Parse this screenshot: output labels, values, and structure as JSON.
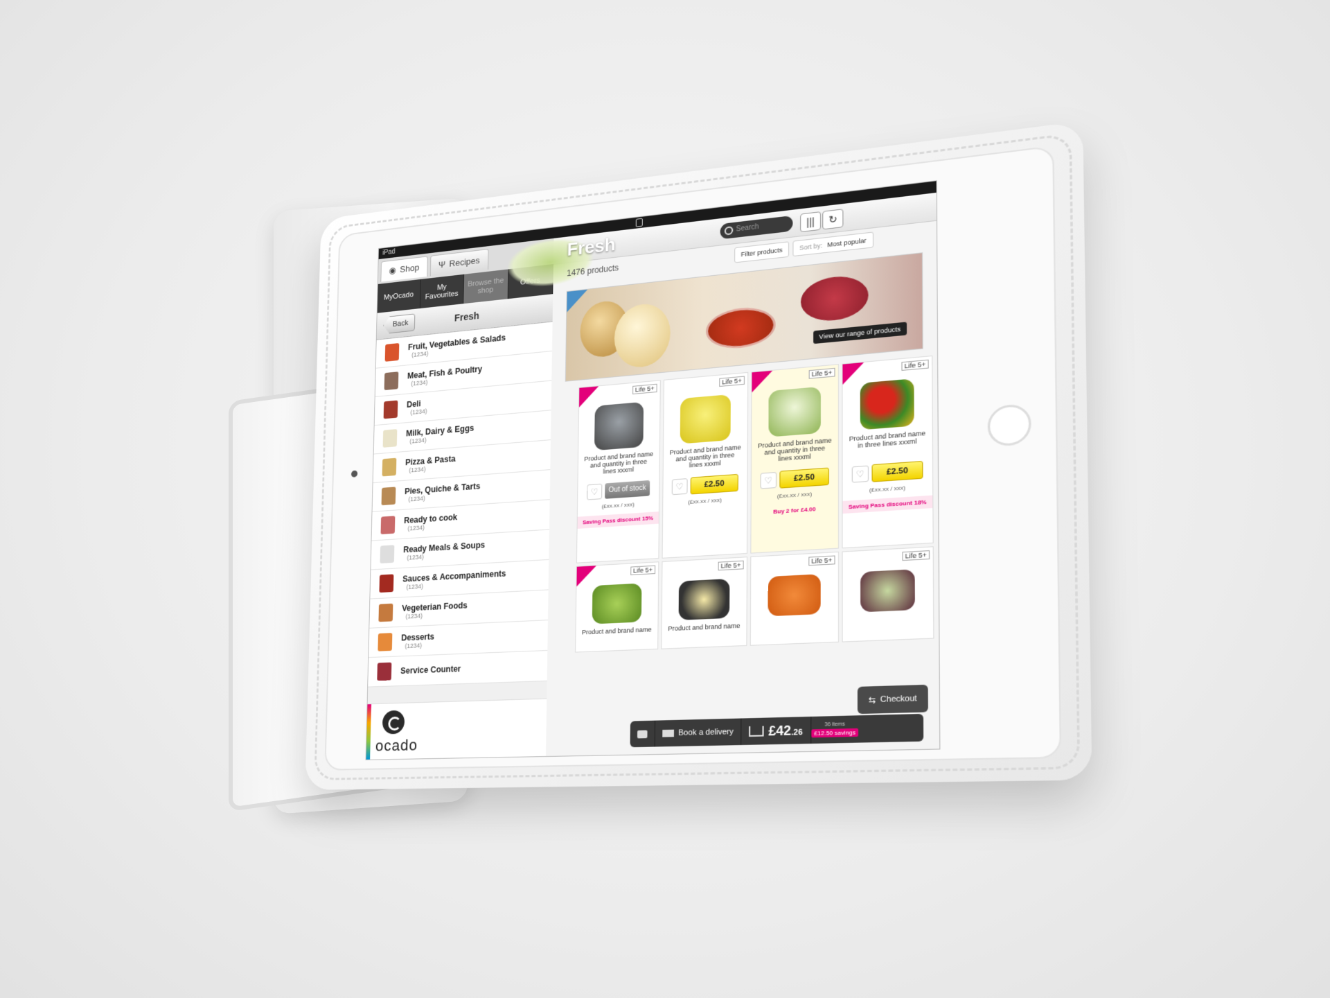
{
  "status": {
    "device": "iPad"
  },
  "tabs": [
    {
      "label": "Shop"
    },
    {
      "label": "Recipes"
    }
  ],
  "segments": [
    {
      "label": "MyOcado"
    },
    {
      "label": "My Favourites"
    },
    {
      "label": "Browse the shop"
    },
    {
      "label": "Offers"
    }
  ],
  "nav": {
    "back_label": "Back",
    "title": "Fresh"
  },
  "categories": [
    {
      "name": "Fruit, Vegetables & Salads",
      "count": "(1234)"
    },
    {
      "name": "Meat, Fish & Poultry",
      "count": "(1234)"
    },
    {
      "name": "Deli",
      "count": "(1234)"
    },
    {
      "name": "Milk, Dairy & Eggs",
      "count": "(1234)"
    },
    {
      "name": "Pizza & Pasta",
      "count": "(1234)"
    },
    {
      "name": "Pies, Quiche & Tarts",
      "count": "(1234)"
    },
    {
      "name": "Ready to cook",
      "count": "(1234)"
    },
    {
      "name": "Ready Meals & Soups",
      "count": "(1234)"
    },
    {
      "name": "Sauces & Accompaniments",
      "count": "(1234)"
    },
    {
      "name": "Vegeterian Foods",
      "count": "(1234)"
    },
    {
      "name": "Desserts",
      "count": "(1234)"
    },
    {
      "name": "Service Counter",
      "count": ""
    }
  ],
  "logo": {
    "text": "ocado"
  },
  "header": {
    "title": "Fresh",
    "search_placeholder": "Search"
  },
  "listing": {
    "count": "1476 products",
    "filter_label": "Filter products",
    "sort_prefix": "Sort by:",
    "sort_value": "Most popular"
  },
  "banner": {
    "cta": "View our range of products"
  },
  "products": [
    {
      "life": "Life 5+",
      "name": "Product and brand name and quantity in three lines xxxml",
      "action": "Out of stock",
      "unit": "(£xx.xx / xxx)",
      "promo": "Saving Pass discount 15%"
    },
    {
      "life": "Life 5+",
      "name": "Product and brand name and quantity in three lines xxxml",
      "action": "£2.50",
      "unit": "(£xx.xx / xxx)",
      "promo": ""
    },
    {
      "life": "Life 5+",
      "name": "Product and brand name and quantity in three lines xxxml",
      "action": "£2.50",
      "unit": "(£xx.xx / xxx)",
      "promo": "Buy 2 for £4.00"
    },
    {
      "life": "Life 5+",
      "name": "Product and brand name in three lines xxxml",
      "action": "£2.50",
      "unit": "(£xx.xx / xxx)",
      "promo": "Saving Pass discount 18%"
    },
    {
      "life": "Life 5+",
      "name": "Product and brand name"
    },
    {
      "life": "Life 5+",
      "name": "Product and brand name"
    },
    {
      "life": "Life 5+",
      "name": ""
    },
    {
      "life": "Life 5+",
      "name": ""
    }
  ],
  "basket": {
    "book_label": "Book a delivery",
    "total_main": "£42",
    "total_pence": ".26",
    "items": "36 items",
    "savings": "£12.50 savings",
    "checkout_label": "Checkout"
  },
  "colors": {
    "brand_pink": "#e3007a",
    "price_yellow": "#f3d400"
  }
}
